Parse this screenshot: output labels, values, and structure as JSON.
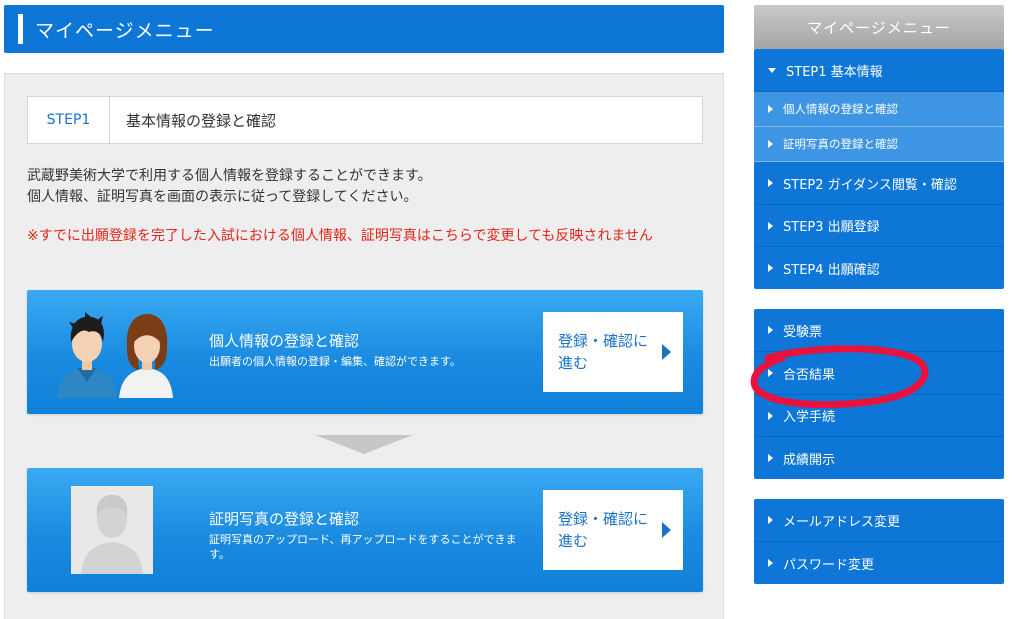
{
  "header": {
    "title": "マイページメニュー"
  },
  "main": {
    "step": {
      "label": "STEP1",
      "title": "基本情報の登録と確認"
    },
    "description": [
      "武蔵野美術大学で利用する個人情報を登録することができます。",
      "個人情報、証明写真を画面の表示に従って登録してください。"
    ],
    "warning": "※すでに出願登録を完了した入試における個人情報、証明写真はこちらで変更しても反映されません",
    "cards": [
      {
        "title": "個人情報の登録と確認",
        "subtitle": "出願者の個人情報の登録・編集、確認ができます。",
        "button": "登録・確認に進む"
      },
      {
        "title": "証明写真の登録と確認",
        "subtitle": "証明写真のアップロード、再アップロードをすることができます。",
        "button": "登録・確認に進む"
      }
    ]
  },
  "sidebar": {
    "title": "マイページメニュー",
    "group1": [
      {
        "label": "STEP1 基本情報"
      },
      {
        "label": "個人情報の登録と確認"
      },
      {
        "label": "証明写真の登録と確認"
      },
      {
        "label": "STEP2 ガイダンス閲覧・確認"
      },
      {
        "label": "STEP3 出願登録"
      },
      {
        "label": "STEP4 出願確認"
      }
    ],
    "group2": [
      {
        "label": "受験票"
      },
      {
        "label": "合否結果"
      },
      {
        "label": "入学手続"
      },
      {
        "label": "成績開示"
      }
    ],
    "group3": [
      {
        "label": "メールアドレス変更"
      },
      {
        "label": "パスワード変更"
      }
    ]
  },
  "colors": {
    "primary": "#0d76d6",
    "warning": "#e0261b",
    "highlight_mark": "#e8123c"
  }
}
